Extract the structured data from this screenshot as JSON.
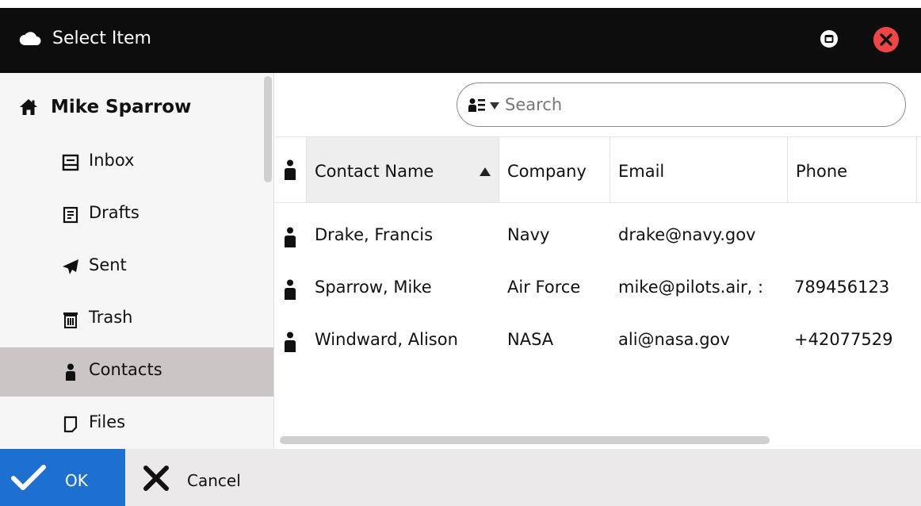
{
  "window": {
    "title": "Select Item",
    "app_icon": "cloud-icon",
    "restore_icon": "restore-icon",
    "close_icon": "close-icon"
  },
  "sidebar": {
    "account": {
      "label": "Mike Sparrow",
      "icon": "home-icon"
    },
    "items": [
      {
        "label": "Inbox",
        "icon": "inbox-icon",
        "active": false
      },
      {
        "label": "Drafts",
        "icon": "drafts-icon",
        "active": false
      },
      {
        "label": "Sent",
        "icon": "paper-plane-icon",
        "active": false
      },
      {
        "label": "Trash",
        "icon": "trash-icon",
        "active": false
      },
      {
        "label": "Contacts",
        "icon": "person-icon",
        "active": true
      },
      {
        "label": "Files",
        "icon": "file-icon",
        "active": false
      }
    ]
  },
  "search": {
    "placeholder": "Search",
    "value": "",
    "filter_icon": "contact-list-icon"
  },
  "table": {
    "columns": [
      "Contact Name",
      "Company",
      "Email",
      "Phone"
    ],
    "sorted_column": "Contact Name",
    "sort_direction": "ascending",
    "rows": [
      {
        "name": "Drake, Francis",
        "company": "Navy",
        "email": "drake@navy.gov",
        "phone": ""
      },
      {
        "name": "Sparrow, Mike",
        "company": "Air Force",
        "email": "mike@pilots.air, :",
        "phone": "789456123"
      },
      {
        "name": "Windward, Alison",
        "company": "NASA",
        "email": "ali@nasa.gov",
        "phone": "+42077529"
      }
    ]
  },
  "footer": {
    "ok_label": "OK",
    "cancel_label": "Cancel"
  },
  "colors": {
    "titlebar": "#0d0d0d",
    "close_button": "#f04545",
    "accent": "#1d6fd0",
    "selected_nav": "#cbc5c5"
  }
}
